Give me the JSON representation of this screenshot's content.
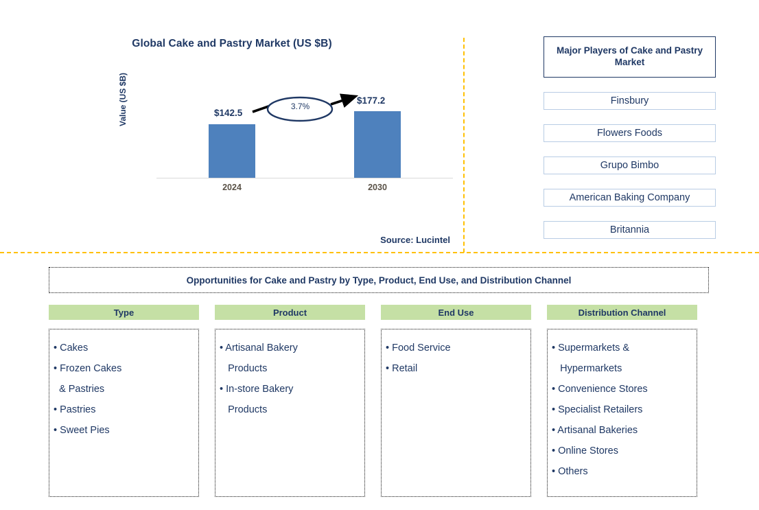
{
  "chart_panel": {
    "title": "Global Cake and Pastry Market (US $B)",
    "y_axis_label": "Value (US $B)",
    "source": "Source: Lucintel"
  },
  "chart_data": {
    "type": "bar",
    "title": "Global Cake and Pastry Market (US $B)",
    "xlabel": "",
    "ylabel": "Value (US $B)",
    "categories": [
      "2024",
      "2030"
    ],
    "values": [
      142.5,
      177.2
    ],
    "value_labels": [
      "$142.5",
      "$177.2"
    ],
    "cagr_label": "3.7%",
    "ylim": [
      0,
      230
    ],
    "grid": false,
    "legend": "none",
    "bar_color": "#4E81BD",
    "annotation": "3.7% CAGR arrow from 2024 to 2030"
  },
  "players": {
    "title": "Major Players of Cake and Pastry Market",
    "items": [
      "Finsbury",
      "Flowers Foods",
      "Grupo Bimbo",
      "American Baking Company",
      "Britannia"
    ]
  },
  "opportunities": {
    "title": "Opportunities for Cake and Pastry by Type, Product, End Use, and Distribution Channel",
    "columns": [
      {
        "header": "Type",
        "items": [
          "• Cakes",
          "• Frozen Cakes\n  & Pastries",
          "• Pastries",
          "• Sweet Pies"
        ]
      },
      {
        "header": "Product",
        "items": [
          "• Artisanal Bakery\n   Products",
          "• In-store Bakery\n   Products"
        ]
      },
      {
        "header": "End Use",
        "items": [
          "• Food Service",
          "• Retail"
        ]
      },
      {
        "header": "Distribution Channel",
        "items": [
          "• Supermarkets &\n   Hypermarkets",
          "• Convenience Stores",
          "• Specialist Retailers",
          "• Artisanal Bakeries",
          "• Online Stores",
          "• Others"
        ]
      }
    ]
  },
  "colors": {
    "bar": "#4E81BD",
    "navy": "#1F3864",
    "green_header": "#C5E0A5",
    "divider_gold": "#FFC000",
    "player_border": "#B8CCE4"
  }
}
